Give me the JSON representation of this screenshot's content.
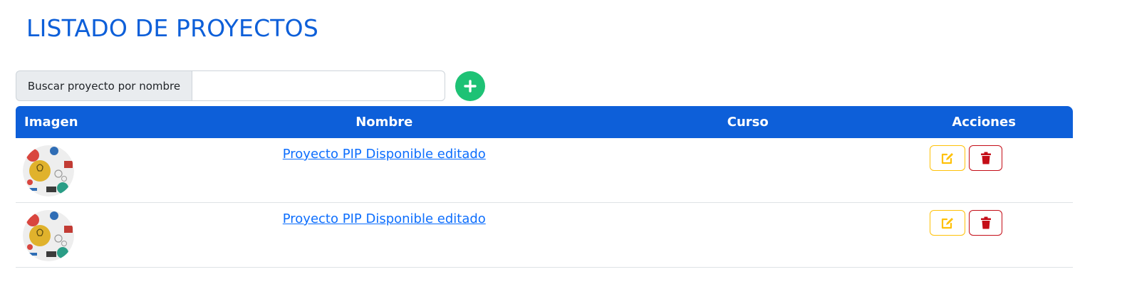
{
  "page": {
    "title": "LISTADO DE PROYECTOS"
  },
  "search": {
    "label": "Buscar proyecto por nombre",
    "value": "",
    "placeholder": ""
  },
  "add_button": {
    "icon": "plus-icon",
    "color": "#1ec275"
  },
  "table": {
    "header_color": "#0d5fd9",
    "columns": [
      "Imagen",
      "Nombre",
      "Curso",
      "Acciones"
    ],
    "rows": [
      {
        "image": "project-thumbnail",
        "name": "Proyecto PIP Disponible editado",
        "curso": ""
      },
      {
        "image": "project-thumbnail",
        "name": "Proyecto PIP Disponible editado",
        "curso": ""
      }
    ]
  },
  "actions": {
    "edit": {
      "icon": "edit-icon",
      "color": "#ffc107"
    },
    "delete": {
      "icon": "trash-icon",
      "color": "#c40d17"
    }
  }
}
